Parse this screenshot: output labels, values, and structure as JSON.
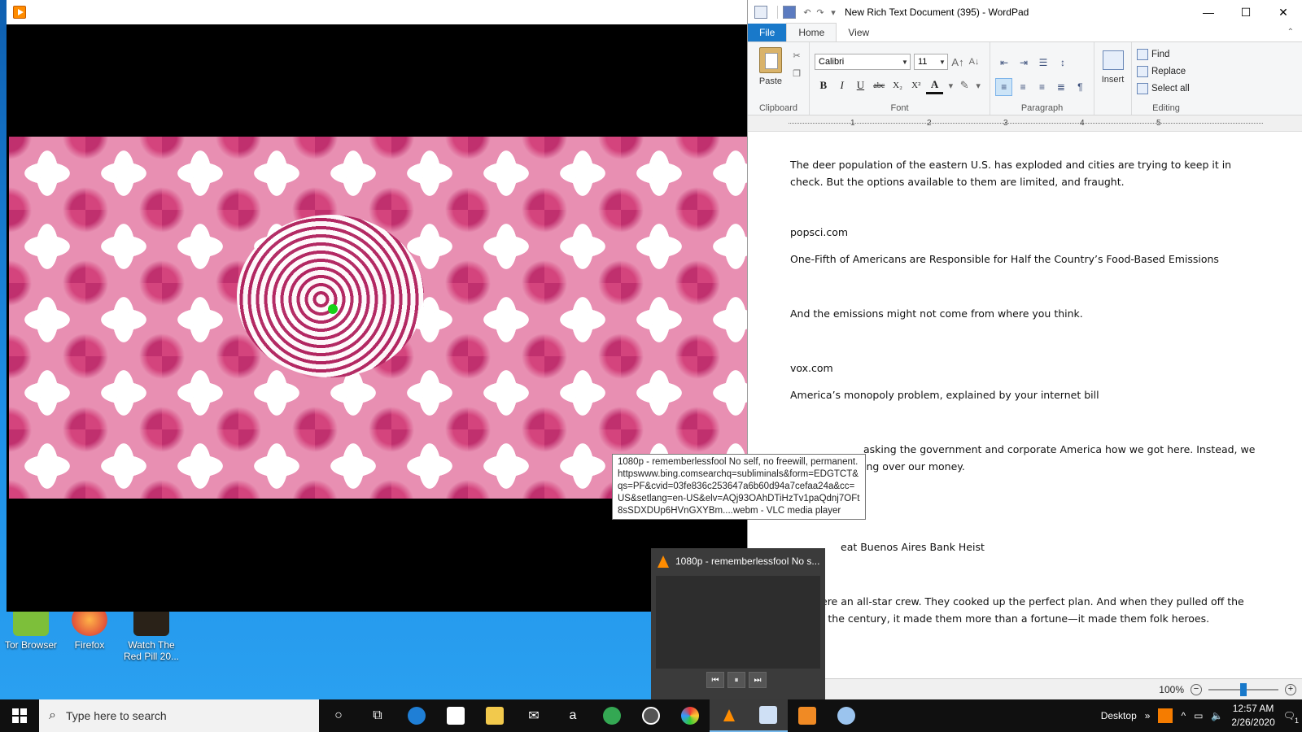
{
  "desktop": {
    "icons": [
      {
        "label": "Tor Browser"
      },
      {
        "label": "Firefox"
      },
      {
        "label": "Watch The Red Pill 20..."
      }
    ]
  },
  "vlc": {
    "tooltip": "1080p - rememberlessfool No self, no freewill, permanent. httpswww.bing.comsearchq=subliminals&form=EDGTCT&qs=PF&cvid=03fe836c253647a6b60d94a7cefaa24a&cc=US&setlang=en-US&elv=AQj93OAhDTiHzTv1paQdnj7OFt8sSDXDUp6HVnGXYBm....webm - VLC media player",
    "thumbnail_title": "1080p - rememberlessfool No s...",
    "controls": {
      "prev": "⏮",
      "pause": "⏸",
      "next": "⏭"
    }
  },
  "wordpad": {
    "title": "New Rich Text Document (395) - WordPad",
    "tabs": {
      "file": "File",
      "home": "Home",
      "view": "View"
    },
    "clipboard": {
      "paste": "Paste",
      "label": "Clipboard"
    },
    "font": {
      "family": "Calibri",
      "size": "11",
      "label": "Font",
      "bold": "B",
      "italic": "I",
      "underline": "U",
      "strike": "abc",
      "sub": "X₂",
      "sup": "X²",
      "color": "A"
    },
    "paragraph": {
      "label": "Paragraph"
    },
    "insert": {
      "label": "Insert"
    },
    "editing": {
      "find": "Find",
      "replace": "Replace",
      "select_all": "Select all",
      "label": "Editing"
    },
    "ruler": [
      "1",
      "2",
      "3",
      "4",
      "5"
    ],
    "paragraphs": [
      "The deer population of the eastern U.S. has exploded and cities are trying to keep it in check. But the options available to them are limited, and fraught.",
      "popsci.com",
      "One-Fifth of Americans are Responsible for Half the Country’s Food-Based Emissions",
      "And the emissions might not come from where you think.",
      "vox.com",
      "America’s monopoly problem, explained by your internet bill",
      "asking the government and corporate America how we got here. Instead, we",
      "ing over our money.",
      "eat Buenos Aires Bank Heist",
      "ere an all-star crew. They cooked up the perfect plan. And when they pulled off the",
      "f the century, it made them more than a fortune—it made them folk heroes."
    ],
    "zoom": "100%",
    "zoom_level": 0.5
  },
  "taskbar": {
    "search_placeholder": "Type here to search",
    "desktop_label": "Desktop",
    "time": "12:57 AM",
    "date": "2/26/2020",
    "notification_count": "1"
  }
}
